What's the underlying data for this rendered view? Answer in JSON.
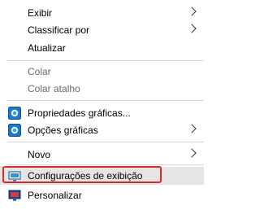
{
  "menu": {
    "items": [
      {
        "label": "Exibir"
      },
      {
        "label": "Classificar por"
      },
      {
        "label": "Atualizar"
      },
      {
        "label": "Colar"
      },
      {
        "label": "Colar atalho"
      },
      {
        "label": "Propriedades gráficas..."
      },
      {
        "label": "Opções gráficas"
      },
      {
        "label": "Novo"
      },
      {
        "label": "Configurações de exibição"
      },
      {
        "label": "Personalizar"
      }
    ]
  },
  "icons": {
    "graphics_properties": "intel-graphics-icon",
    "graphics_options": "intel-graphics-icon",
    "display_settings": "display-icon",
    "personalize": "personalize-icon"
  },
  "colors": {
    "highlight": "#e5e5e5",
    "annotation_box": "#e12b2b",
    "disabled_text": "#6d6d6d"
  }
}
